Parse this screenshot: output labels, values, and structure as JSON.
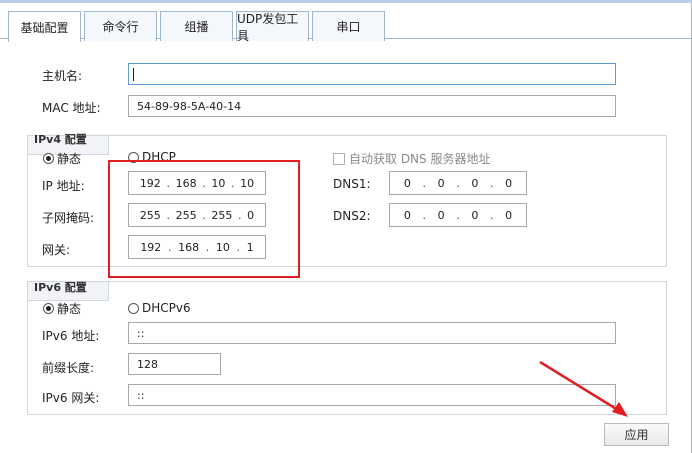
{
  "tabs": [
    "基础配置",
    "命令行",
    "组播",
    "UDP发包工具",
    "串口"
  ],
  "hostname": {
    "label": "主机名:",
    "value": ""
  },
  "mac": {
    "label": "MAC 地址:",
    "value": "54-89-98-5A-40-14"
  },
  "ipv4": {
    "title": "IPv4 配置",
    "radio_static": "静态",
    "radio_dhcp": "DHCP",
    "dns_auto": "自动获取 DNS 服务器地址",
    "ip_label": "IP 地址:",
    "ip": [
      "192",
      "168",
      "10",
      "10"
    ],
    "mask_label": "子网掩码:",
    "mask": [
      "255",
      "255",
      "255",
      "0"
    ],
    "gw_label": "网关:",
    "gw": [
      "192",
      "168",
      "10",
      "1"
    ],
    "dns1_label": "DNS1:",
    "dns1": [
      "0",
      "0",
      "0",
      "0"
    ],
    "dns2_label": "DNS2:",
    "dns2": [
      "0",
      "0",
      "0",
      "0"
    ],
    "static_selected": true
  },
  "ipv6": {
    "title": "IPv6 配置",
    "radio_static": "静态",
    "radio_dhcp": "DHCPv6",
    "addr_label": "IPv6 地址:",
    "addr": "::",
    "prefix_label": "前缀长度:",
    "prefix": "128",
    "gw_label": "IPv6 网关:",
    "gw": "::",
    "static_selected": true
  },
  "apply_label": "应用",
  "colors": {
    "highlight": "#e02020",
    "tab_border": "#9fb6cd",
    "focus_border": "#5b9bd5"
  }
}
